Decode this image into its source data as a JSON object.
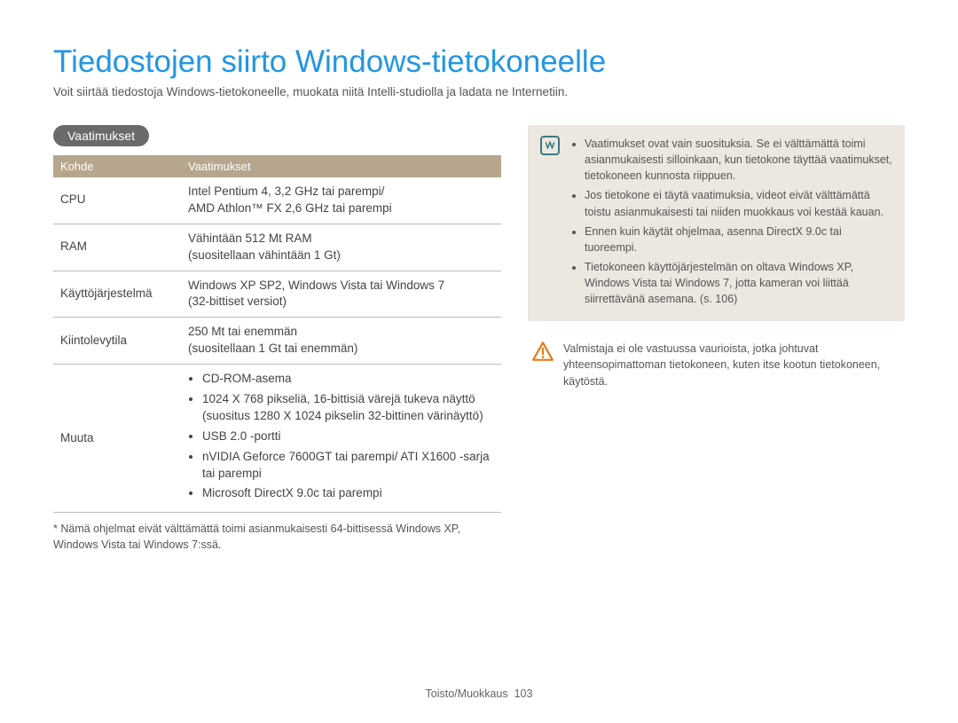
{
  "title": "Tiedostojen siirto Windows-tietokoneelle",
  "subtitle": "Voit siirtää tiedostoja Windows-tietokoneelle, muokata niitä Intelli-studiolla ja ladata ne Internetiin.",
  "requirements_label": "Vaatimukset",
  "table_headers": {
    "col1": "Kohde",
    "col2": "Vaatimukset"
  },
  "rows": {
    "cpu_key": "CPU",
    "cpu_val": "Intel Pentium 4, 3,2 GHz tai parempi/\nAMD Athlon™ FX 2,6 GHz tai parempi",
    "ram_key": "RAM",
    "ram_val": "Vähintään 512 Mt RAM\n(suositellaan vähintään 1 Gt)",
    "os_key": "Käyttöjärjestelmä",
    "os_val": "Windows XP SP2, Windows Vista tai Windows 7\n(32-bittiset versiot)",
    "hdd_key": "Kiintolevytila",
    "hdd_val": "250 Mt tai enemmän\n(suositellaan 1 Gt tai enemmän)",
    "other_key": "Muuta",
    "other_items": [
      "CD-ROM-asema",
      "1024 X 768 pikseliä, 16-bittisiä värejä tukeva näyttö (suositus 1280 X 1024 pikselin 32-bittinen värinäyttö)",
      "USB 2.0 -portti",
      "nVIDIA Geforce 7600GT tai parempi/ ATI X1600 -sarja tai parempi",
      "Microsoft DirectX 9.0c tai parempi"
    ]
  },
  "table_footnote": "* Nämä ohjelmat eivät välttämättä toimi asianmukaisesti 64-bittisessä Windows XP, Windows Vista tai Windows 7:ssä.",
  "info_notes": [
    "Vaatimukset ovat vain suosituksia. Se ei välttämättä toimi asianmukaisesti silloinkaan, kun tietokone täyttää vaatimukset, tietokoneen kunnosta riippuen.",
    "Jos tietokone ei täytä vaatimuksia, videot eivät välttämättä toistu asianmukaisesti tai niiden muokkaus voi kestää kauan.",
    "Ennen kuin käytät ohjelmaa, asenna DirectX 9.0c tai tuoreempi.",
    "Tietokoneen käyttöjärjestelmän on oltava Windows XP, Windows Vista tai Windows 7, jotta kameran voi liittää siirrettävänä asemana. (s. 106)"
  ],
  "warning_text": "Valmistaja ei ole vastuussa vaurioista, jotka johtuvat yhteensopimattoman tietokoneen, kuten itse kootun tietokoneen, käytöstä.",
  "footer": {
    "section": "Toisto/Muokkaus",
    "page": "103"
  },
  "icons": {
    "note": "note-icon",
    "warn": "warning-icon"
  }
}
